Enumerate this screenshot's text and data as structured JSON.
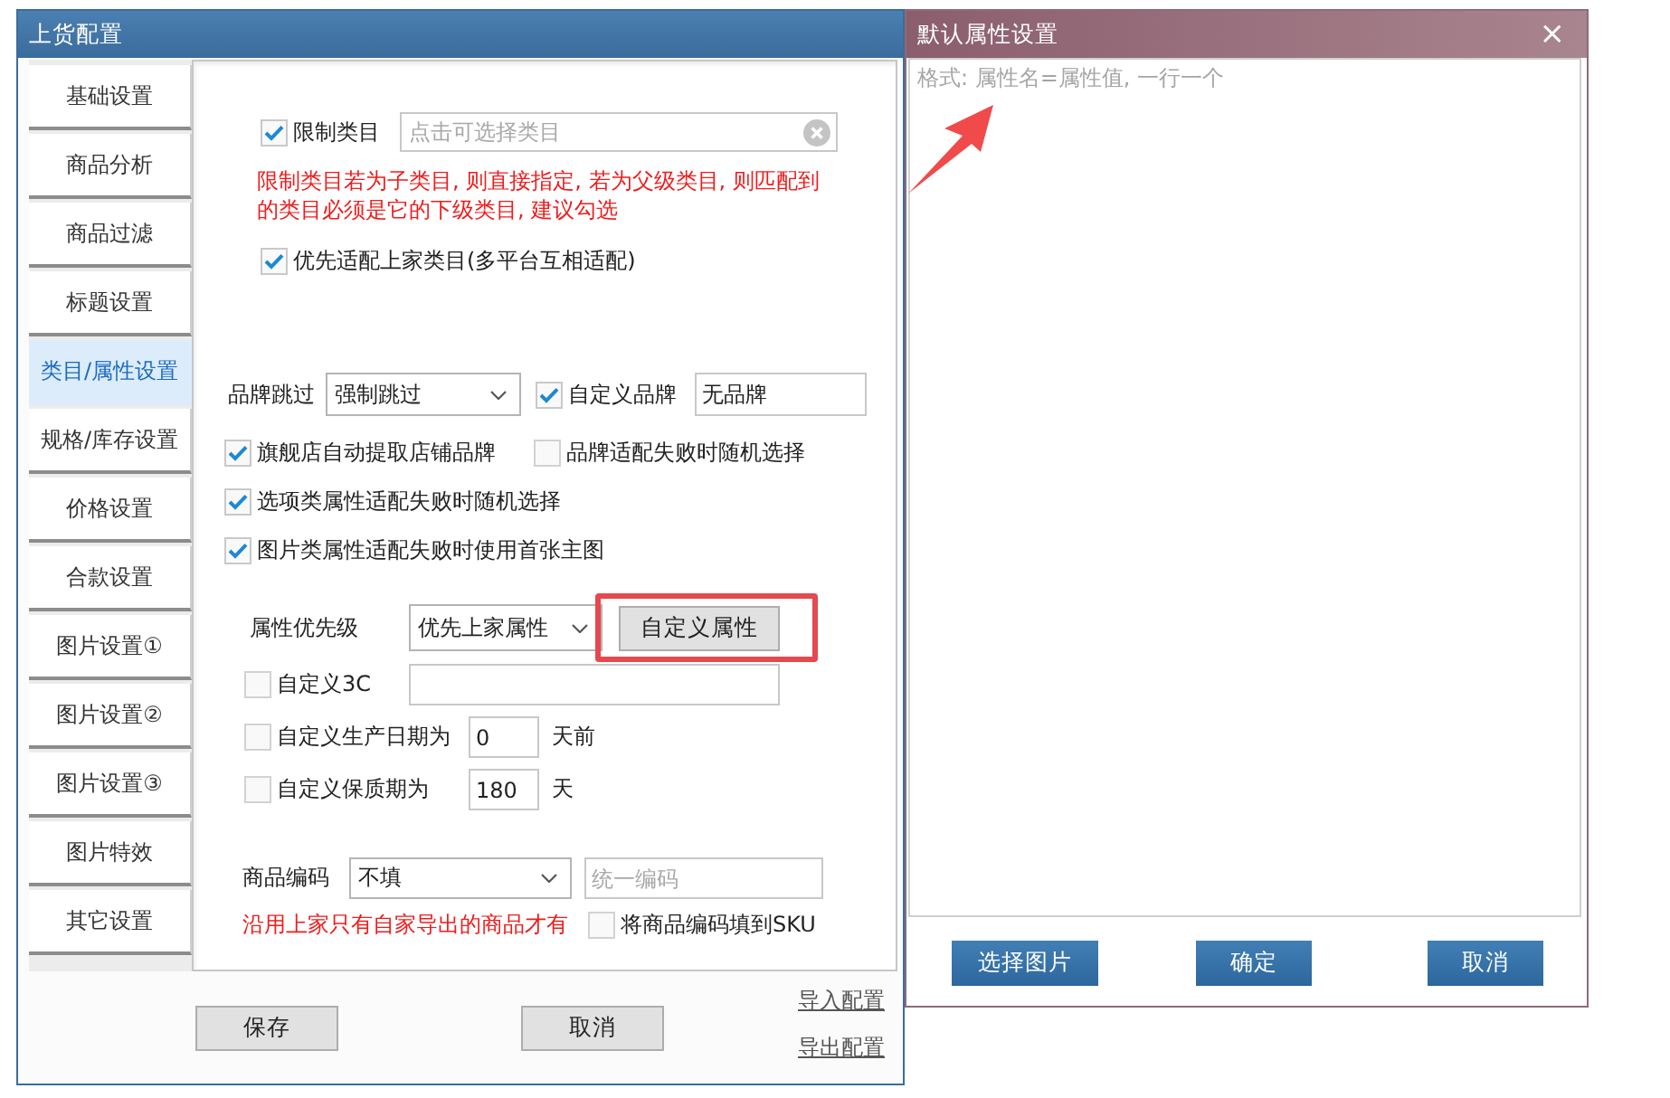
{
  "main_window": {
    "title": "上货配置",
    "sidebar": {
      "items": [
        {
          "label": "基础设置",
          "selected": false
        },
        {
          "label": "商品分析",
          "selected": false
        },
        {
          "label": "商品过滤",
          "selected": false
        },
        {
          "label": "标题设置",
          "selected": false
        },
        {
          "label": "类目/属性设置",
          "selected": true
        },
        {
          "label": "规格/库存设置",
          "selected": false
        },
        {
          "label": "价格设置",
          "selected": false
        },
        {
          "label": "合款设置",
          "selected": false
        },
        {
          "label": "图片设置①",
          "selected": false
        },
        {
          "label": "图片设置②",
          "selected": false
        },
        {
          "label": "图片设置③",
          "selected": false
        },
        {
          "label": "图片特效",
          "selected": false
        },
        {
          "label": "其它设置",
          "selected": false
        }
      ]
    },
    "category": {
      "restrict": {
        "label": "限制类目",
        "checked": true,
        "placeholder": "点击可选择类目"
      },
      "note": "限制类目若为子类目, 则直接指定, 若为父级类目, 则匹配到的类目必须是它的下级类目, 建议勾选",
      "prefer_source": {
        "label": "优先适配上家类目(多平台互相适配)",
        "checked": true
      }
    },
    "brand": {
      "skip": {
        "label": "品牌跳过",
        "value": "强制跳过"
      },
      "custom_brand": {
        "label": "自定义品牌",
        "checked": true,
        "value": "无品牌"
      },
      "options": [
        [
          {
            "label": "旗舰店自动提取店铺品牌",
            "checked": true
          },
          {
            "label": "品牌适配失败时随机选择",
            "checked": false
          }
        ],
        [
          {
            "label": "选项类属性适配失败时随机选择",
            "checked": true
          }
        ],
        [
          {
            "label": "图片类属性适配失败时使用首张主图",
            "checked": true
          }
        ]
      ]
    },
    "attributes": {
      "priority": {
        "label": "属性优先级",
        "value": "优先上家属性",
        "button": "自定义属性"
      },
      "custom_3c": {
        "label": "自定义3C",
        "checked": false
      },
      "production_date": {
        "label": "自定义生产日期为",
        "checked": false,
        "value": "0",
        "unit": "天前"
      },
      "shelf_life": {
        "label": "自定义保质期为",
        "checked": false,
        "value": "180",
        "unit": "天"
      }
    },
    "product_code": {
      "label": "商品编码",
      "value": "不填",
      "placeholder": "统一编码",
      "note": "沿用上家只有自家导出的商品才有",
      "fill_sku": {
        "label": "将商品编码填到SKU",
        "checked": false
      }
    },
    "buttons": [
      "保存",
      "取消"
    ],
    "links": [
      "导入配置",
      "导出配置"
    ]
  },
  "attribute_window": {
    "title": "默认属性设置",
    "close": "×",
    "placeholder": "格式: 属性名=属性值, 一行一个",
    "buttons": [
      "选择图片",
      "确定",
      "取消"
    ]
  }
}
